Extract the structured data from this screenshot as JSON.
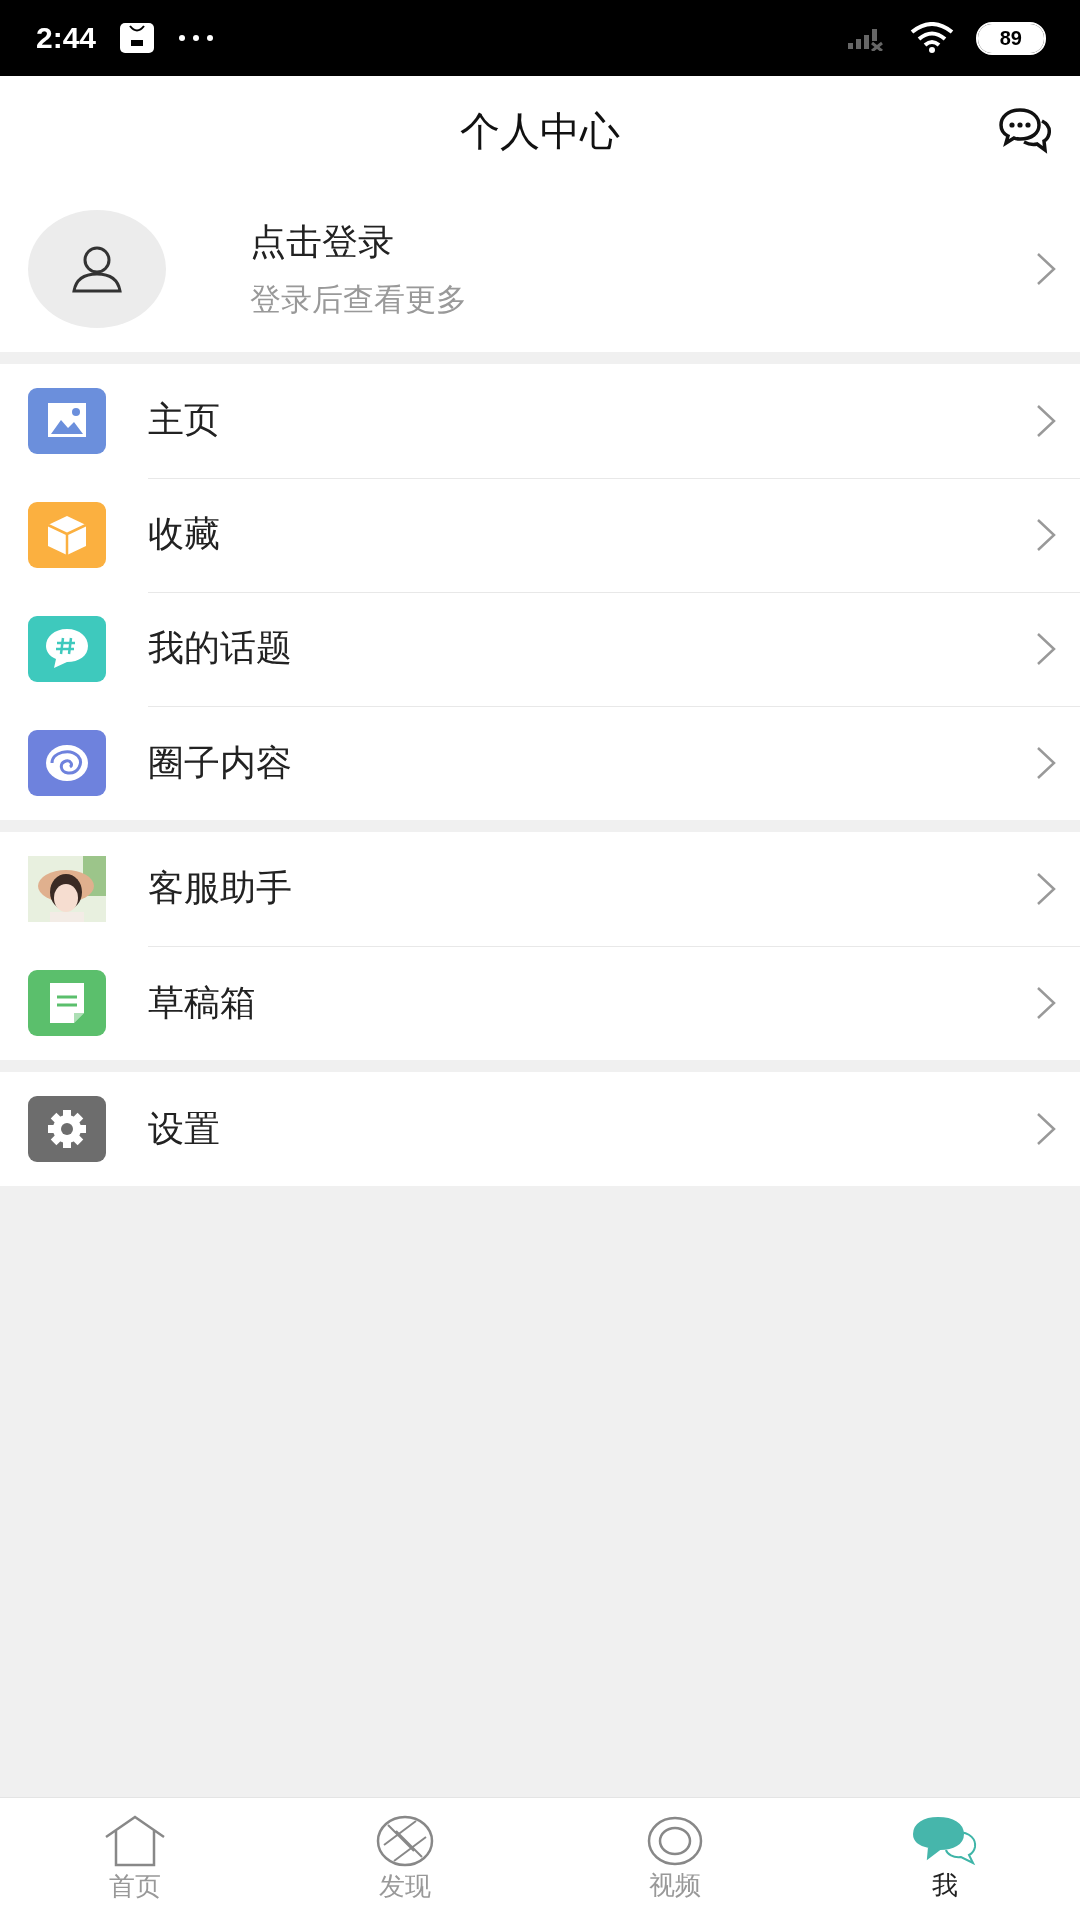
{
  "status_bar": {
    "time": "2:44",
    "battery": "89"
  },
  "header": {
    "title": "个人中心"
  },
  "profile": {
    "name": "点击登录",
    "subtitle": "登录后查看更多"
  },
  "sections": [
    {
      "items": [
        {
          "label": "主页",
          "kind": "icon",
          "color": "#6b8fdc"
        },
        {
          "label": "收藏",
          "kind": "icon",
          "color": "#fbb040"
        },
        {
          "label": "我的话题",
          "kind": "icon",
          "color": "#3ec9bd"
        },
        {
          "label": "圈子内容",
          "kind": "icon",
          "color": "#6e82dd"
        }
      ]
    },
    {
      "items": [
        {
          "label": "客服助手",
          "kind": "picture"
        },
        {
          "label": "草稿箱",
          "kind": "icon",
          "color": "#5bbf6c"
        }
      ]
    },
    {
      "items": [
        {
          "label": "设置",
          "kind": "icon",
          "color": "#6d6d6d"
        }
      ]
    }
  ],
  "tabs": [
    {
      "label": "首页",
      "selected": false
    },
    {
      "label": "发现",
      "selected": false
    },
    {
      "label": "视频",
      "selected": false
    },
    {
      "label": "我",
      "selected": true
    }
  ]
}
